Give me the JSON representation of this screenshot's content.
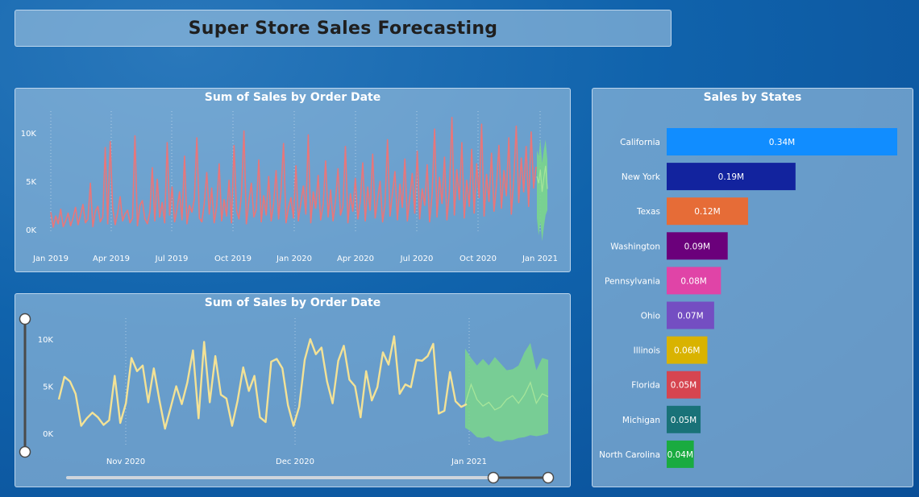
{
  "page": {
    "title": "Super Store Sales Forecasting"
  },
  "colors": {
    "line_main": "#e8767a",
    "line_zoom": "#f3e296",
    "forecast_band": "#7bd68c",
    "forecast_line": "#a6e59a"
  },
  "chart_data": [
    {
      "id": "daily",
      "type": "line",
      "title": "Sum of Sales by Order Date",
      "x_ticks": [
        "Jan 2019",
        "Apr 2019",
        "Jul 2019",
        "Oct 2019",
        "Jan 2020",
        "Apr 2020",
        "Jul 2020",
        "Oct 2020",
        "Jan 2021"
      ],
      "y_ticks": [
        "0K",
        "5K",
        "10K"
      ],
      "ylim": [
        0,
        12000
      ],
      "x_range": [
        "2019-01-01",
        "2021-01-15"
      ],
      "grid": "vertical dotted",
      "series": [
        {
          "values": [
            1800,
            250,
            1400,
            600,
            2100,
            300,
            900,
            1700,
            400,
            1200,
            2300,
            500,
            1500,
            2600,
            700,
            1100,
            4800,
            300,
            1900,
            2400,
            800,
            1300,
            8500,
            600,
            9100,
            2200,
            500,
            1700,
            3400,
            900,
            1600,
            2000,
            700,
            1200,
            9700,
            400,
            2500,
            3000,
            1100,
            600,
            1800,
            6400,
            900,
            5200,
            1300,
            2800,
            700,
            9000,
            1500,
            4400,
            800,
            2100,
            3900,
            1000,
            7600,
            600,
            2500,
            1800,
            3200,
            9500,
            1200,
            800,
            2700,
            5900,
            1600,
            4300,
            700,
            2400,
            6800,
            900,
            3100,
            1400,
            5100,
            700,
            8700,
            2000,
            1100,
            3600,
            10200,
            600,
            2900,
            4800,
            1300,
            2100,
            7200,
            800,
            3500,
            1500,
            5500,
            900,
            2700,
            6100,
            1100,
            4000,
            8900,
            700,
            2300,
            3300,
            1200,
            6600,
            900,
            2800,
            4500,
            1600,
            9800,
            700,
            3900,
            2200,
            5600,
            1000,
            2600,
            7100,
            1300,
            4100,
            900,
            3000,
            6300,
            1500,
            2400,
            8600,
            700,
            3700,
            1900,
            5300,
            1100,
            2900,
            6900,
            900,
            4400,
            2000,
            7800,
            1200,
            3200,
            5000,
            800,
            2600,
            9300,
            1400,
            3800,
            6000,
            1000,
            4700,
            2300,
            7300,
            900,
            3400,
            5800,
            1700,
            8100,
            1100,
            4200,
            2500,
            6700,
            800,
            3600,
            10400,
            1300,
            5400,
            2700,
            7500,
            1000,
            4000,
            11600,
            1500,
            6200,
            3100,
            9000,
            1200,
            5100,
            2400,
            8300,
            1700,
            6800,
            3300,
            10900,
            1400,
            5700,
            2900,
            7900,
            1900,
            4600,
            8700,
            2200,
            6100,
            3500,
            9500,
            1600,
            5300,
            10700,
            2800,
            7400,
            3900,
            8600,
            2400,
            10100,
            4300,
            6500
          ]
        },
        {
          "name": "forecast",
          "values": [
            5500,
            4800,
            6200,
            3900,
            5400,
            6600,
            4200
          ]
        },
        {
          "name": "forecast_lower",
          "values": [
            1200,
            -600,
            800,
            -1200,
            300,
            1500,
            2000
          ]
        },
        {
          "name": "forecast_upper",
          "values": [
            8200,
            7600,
            9400,
            6900,
            8300,
            9300,
            7200
          ]
        }
      ]
    },
    {
      "id": "zoom",
      "type": "line",
      "title": "Sum of Sales by Order Date",
      "x_ticks": [
        "Nov 2020",
        "Dec 2020",
        "Jan 2021"
      ],
      "y_ticks": [
        "0K",
        "5K",
        "10K"
      ],
      "ylim": [
        -500,
        11000
      ],
      "x_range": [
        "2020-10-17",
        "2021-01-15"
      ],
      "grid": "vertical dotted",
      "series": [
        {
          "values": [
            3600,
            6000,
            5500,
            4200,
            800,
            1600,
            2200,
            1700,
            900,
            1400,
            6100,
            1100,
            3200,
            8000,
            6600,
            7200,
            3300,
            6900,
            3500,
            500,
            2700,
            5000,
            3100,
            5400,
            8800,
            1600,
            9700,
            3300,
            8200,
            4100,
            3700,
            800,
            3500,
            7000,
            4500,
            6100,
            1700,
            1200,
            7600,
            7900,
            6900,
            3000,
            800,
            2800,
            7800,
            10000,
            8400,
            9100,
            5500,
            3200,
            7700,
            9300,
            5700,
            5000,
            1700,
            6600,
            3500,
            4900,
            8600,
            7300,
            10300,
            4200,
            5200,
            4900,
            7800,
            7700,
            8200,
            9500,
            2100,
            2400,
            6500,
            3400,
            2800,
            3100
          ]
        },
        {
          "name": "forecast",
          "values": [
            3100,
            5200,
            3600,
            2900,
            3300,
            2500,
            2800,
            3600,
            4000,
            3200,
            4100,
            5400,
            3200,
            4200,
            3900
          ]
        },
        {
          "name": "forecast_lower",
          "values": [
            600,
            200,
            -400,
            -500,
            -300,
            -800,
            -900,
            -700,
            -700,
            -500,
            -400,
            -200,
            -300,
            -200,
            0
          ]
        },
        {
          "name": "forecast_upper",
          "values": [
            9000,
            8000,
            7200,
            7900,
            7200,
            8100,
            7400,
            6700,
            6800,
            7200,
            8600,
            9600,
            6700,
            8000,
            7800
          ]
        }
      ]
    },
    {
      "id": "states",
      "type": "bar",
      "orientation": "horizontal",
      "title": "Sales by States",
      "categories": [
        "California",
        "New York",
        "Texas",
        "Washington",
        "Pennsylvania",
        "Ohio",
        "Illinois",
        "Florida",
        "Michigan",
        "North Carolina"
      ],
      "values": [
        0.34,
        0.19,
        0.12,
        0.09,
        0.08,
        0.07,
        0.06,
        0.05,
        0.05,
        0.04
      ],
      "value_labels": [
        "0.34M",
        "0.19M",
        "0.12M",
        "0.09M",
        "0.08M",
        "0.07M",
        "0.06M",
        "0.05M",
        "0.05M",
        "0.04M"
      ],
      "colors": [
        "#118dff",
        "#12239e",
        "#e66c37",
        "#6b007b",
        "#e044a7",
        "#744ec2",
        "#d9b300",
        "#d64550",
        "#197278",
        "#1aab40"
      ],
      "xlim": [
        0,
        0.34
      ]
    }
  ]
}
